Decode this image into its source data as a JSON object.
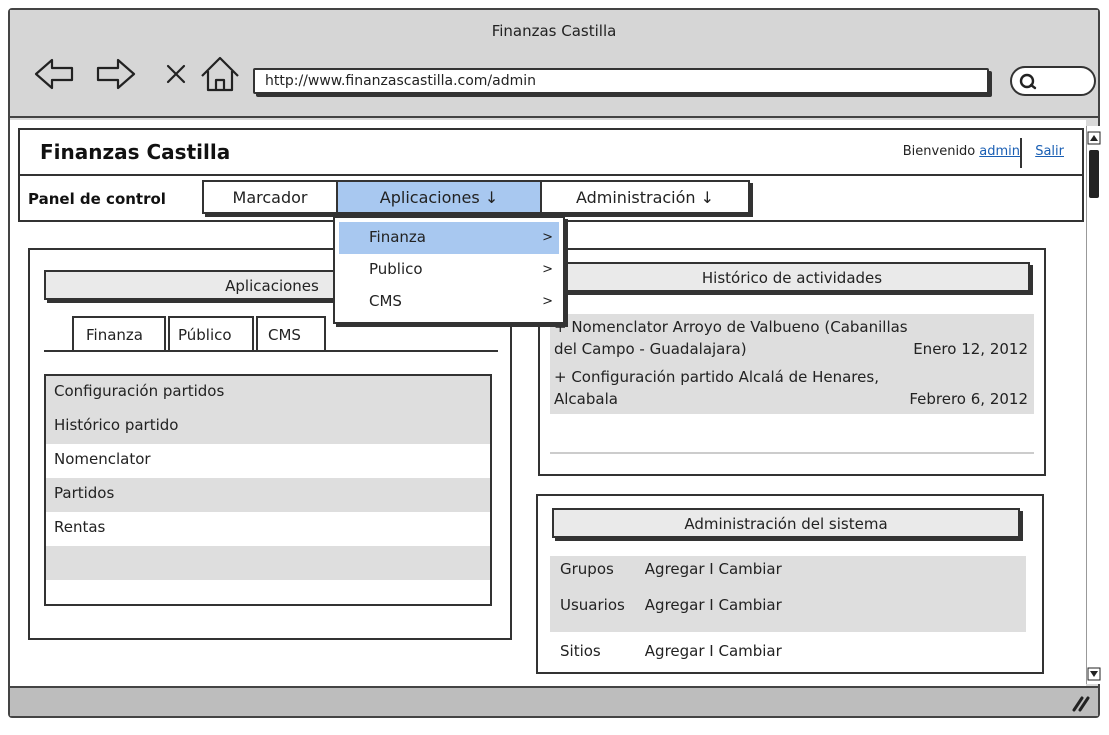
{
  "window": {
    "title": "Finanzas Castilla",
    "url": "http://www.finanzascastilla.com/admin"
  },
  "header": {
    "site_title": "Finanzas Castilla",
    "welcome_text": "Bienvenido",
    "user_link": "admin",
    "logout_link": "Salir"
  },
  "nav": {
    "panel_label": "Panel de control",
    "tabs": [
      {
        "label": "Marcador",
        "active": false
      },
      {
        "label": "Aplicaciones ↓",
        "active": true
      },
      {
        "label": "Administración ↓",
        "active": false
      }
    ],
    "dropdown": [
      {
        "label": "Finanza",
        "arrow": ">",
        "selected": true
      },
      {
        "label": "Publico",
        "arrow": ">",
        "selected": false
      },
      {
        "label": "CMS",
        "arrow": ">",
        "selected": false
      }
    ]
  },
  "applications": {
    "heading": "Aplicaciones",
    "subtabs": [
      "Finanza",
      "Público",
      "CMS"
    ],
    "items": [
      "Configuración partidos",
      "Histórico partido",
      "Nomenclator",
      "Partidos",
      "Rentas"
    ]
  },
  "history": {
    "heading": "Histórico de actividades",
    "entries": [
      {
        "line1": "+ Nomenclator Arroyo de Valbueno (Cabanillas",
        "line2": "del Campo - Guadalajara)",
        "date": "Enero 12, 2012"
      },
      {
        "line1": "+ Configuración partido Alcalá de Henares,",
        "line2": "Alcabala",
        "date": "Febrero 6, 2012"
      }
    ]
  },
  "admin": {
    "heading": "Administración del sistema",
    "rows": [
      {
        "label": "Grupos",
        "actions": "Agregar I Cambiar"
      },
      {
        "label": "Usuarios",
        "actions": "Agregar I Cambiar"
      },
      {
        "label": "Sitios",
        "actions": "Agregar I Cambiar"
      }
    ]
  },
  "colors": {
    "accent": "#a8c8f0",
    "row_grey": "#dedede",
    "link": "#1a5fb4"
  }
}
